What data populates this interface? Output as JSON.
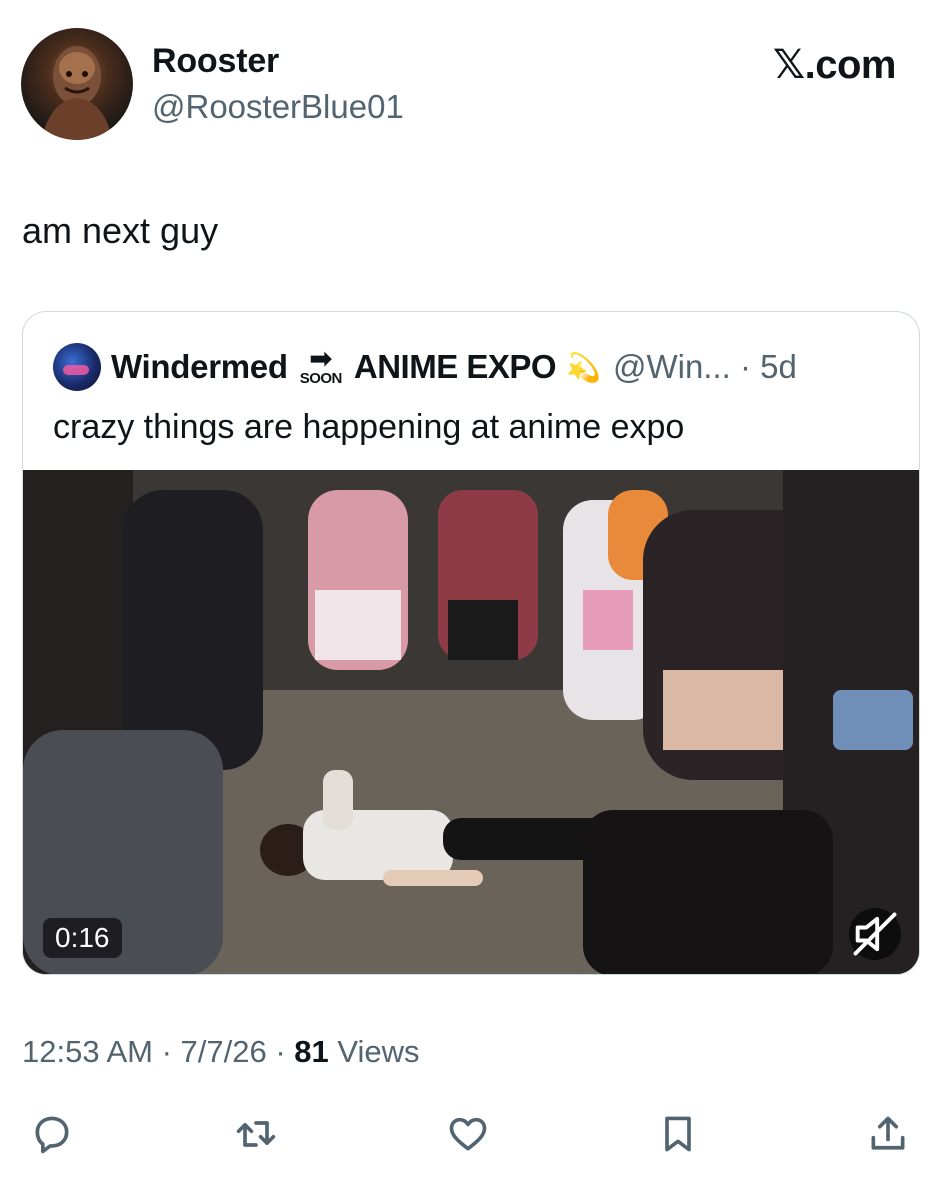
{
  "author": {
    "display_name": "Rooster",
    "handle": "@RoosterBlue01",
    "avatar_icon": "avatar-image"
  },
  "brand": "𝕏.com",
  "post": {
    "text": "am next guy"
  },
  "quoted_post": {
    "display_name": "Windermed",
    "soon_arrow": "➡",
    "soon_label": "SOON",
    "display_name_suffix": "ANIME EXPO",
    "emoji": "💫",
    "handle_time": "@Win... · 5d",
    "text": "crazy things are happening at anime expo",
    "video": {
      "duration": "0:16",
      "muted": true
    }
  },
  "meta": {
    "time_date": "12:53 AM · 7/7/26 · ",
    "views_count": "81",
    "views_label": " Views"
  },
  "actions": [
    "reply-icon",
    "repost-icon",
    "like-icon",
    "bookmark-icon",
    "share-icon"
  ],
  "colors": {
    "text": "#0f1419",
    "secondary": "#536471",
    "border": "#cfd9de"
  }
}
